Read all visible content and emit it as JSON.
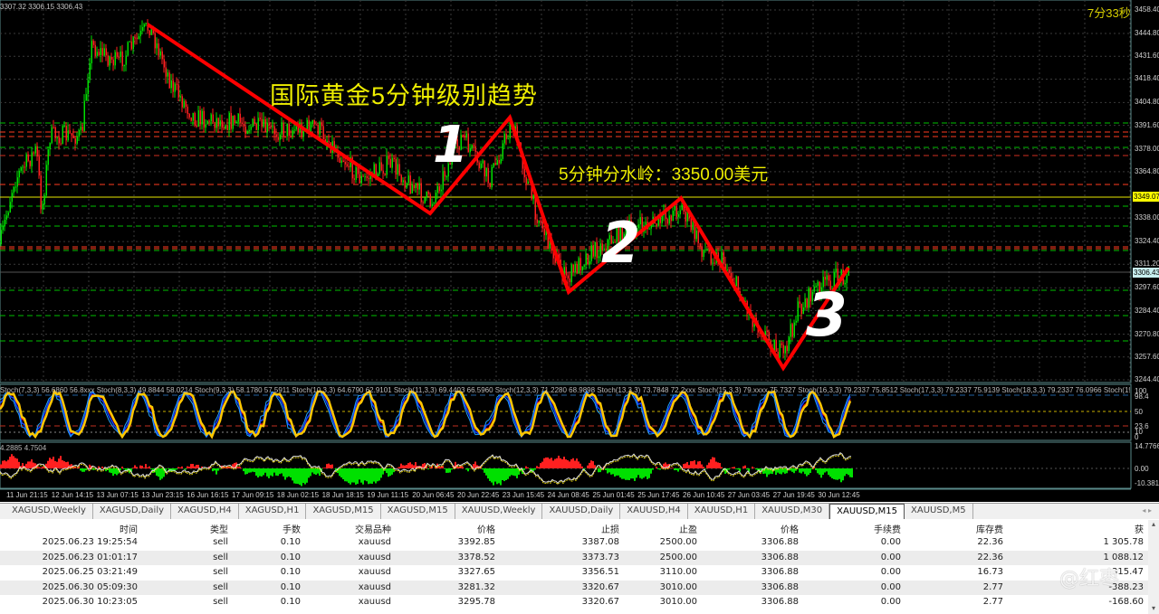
{
  "chart": {
    "ohlc_readout": "3307.32 3306.15 3306.43",
    "countdown": "7分33秒",
    "annotation_title": "国际黄金5分钟级别趋势",
    "annotation_level": "5分钟分水岭：3350.00美元",
    "wave_labels": [
      "1",
      "2",
      "3"
    ],
    "price_axis": [
      "3458.40",
      "3444.80",
      "3431.60",
      "3418.40",
      "3404.80",
      "3391.60",
      "3378.00",
      "3364.80",
      "3338.00",
      "3324.40",
      "3311.20",
      "3297.60",
      "3284.40",
      "3270.80",
      "3257.60",
      "3244.40"
    ],
    "level_tag": "3349.07",
    "current_price_tag": "3306.43",
    "stoch_label": "Stoch(7,3,3) 56.6860 56.8xxx  Stoch(8,3,3) 49.8844 58.0214  Stoch(9,3,3) 58.1780 57.5911  Stoch(10,3,3) 64.6790 62.9101  Stoch(11,3,3) 69.4403 66.5960  Stoch(12,3,3) 71.2280 68.9898  Stoch(13,3,3) 73.7848 72.2xxx  Stoch(15,3,3) 79.xxxx 75.7327  Stoch(16,3,3) 79.2337 75.8512  Stoch(17,3,3) 79.2337 75.9139  Stoch(18,3,3) 79.2337 76.0966  Stoch(19,3,3) 79.2337 76.5600  Stoch",
    "stoch_axis": [
      "100",
      "98.4",
      "50",
      "23.6",
      "10",
      "0"
    ],
    "macd_label": "4.2885 4.7504",
    "macd_axis": [
      "14.7766",
      "0.00",
      "-10.381"
    ],
    "time_axis": [
      "11 Jun 21:15",
      "12 Jun 14:15",
      "13 Jun 07:15",
      "13 Jun 23:15",
      "16 Jun 16:15",
      "17 Jun 09:15",
      "18 Jun 02:15",
      "18 Jun 18:15",
      "19 Jun 11:15",
      "20 Jun 06:45",
      "20 Jun 22:45",
      "23 Jun 15:45",
      "24 Jun 08:45",
      "25 Jun 01:45",
      "25 Jun 17:45",
      "26 Jun 10:45",
      "27 Jun 03:45",
      "27 Jun 19:45",
      "30 Jun 12:45"
    ],
    "colors": {
      "bull": "#00e000",
      "bear": "#ff2020",
      "trend_line": "#ff0000",
      "annotation": "#eeee00",
      "stoch_main": "#ffc800"
    }
  },
  "tabs": [
    {
      "label": "XAGUSD,Weekly"
    },
    {
      "label": "XAGUSD,Daily"
    },
    {
      "label": "XAGUSD,H4"
    },
    {
      "label": "XAGUSD,H1"
    },
    {
      "label": "XAGUSD,M15"
    },
    {
      "label": "XAGUSD,M15"
    },
    {
      "label": "XAUUSD,Weekly"
    },
    {
      "label": "XAUUSD,Daily"
    },
    {
      "label": "XAUUSD,H4"
    },
    {
      "label": "XAUUSD,H1"
    },
    {
      "label": "XAUUSD,M30"
    },
    {
      "label": "XAUUSD,M15",
      "active": true
    },
    {
      "label": "XAUUSD,M5"
    }
  ],
  "table": {
    "headers": [
      "时间",
      "类型",
      "手数",
      "交易品种",
      "价格",
      "止损",
      "止盈",
      "价格",
      "手续费",
      "库存费",
      "获"
    ],
    "rows": [
      [
        "2025.06.23 19:25:54",
        "sell",
        "0.10",
        "xauusd",
        "3392.85",
        "3387.08",
        "2500.00",
        "3306.88",
        "0.00",
        "22.36",
        "1 305.78"
      ],
      [
        "2025.06.23 01:01:17",
        "sell",
        "0.10",
        "xauusd",
        "3378.52",
        "3373.73",
        "2500.00",
        "3306.88",
        "0.00",
        "22.36",
        "1 088.12"
      ],
      [
        "2025.06.25 03:21:49",
        "sell",
        "0.10",
        "xauusd",
        "3327.65",
        "3356.51",
        "3110.00",
        "3306.88",
        "0.00",
        "16.73",
        "315.47"
      ],
      [
        "2025.06.30 05:09:30",
        "sell",
        "0.10",
        "xauusd",
        "3281.32",
        "3320.67",
        "3010.00",
        "3306.88",
        "0.00",
        "2.77",
        "-388.23"
      ],
      [
        "2025.06.30 10:23:05",
        "sell",
        "0.10",
        "xauusd",
        "3295.78",
        "3320.67",
        "3010.00",
        "3306.88",
        "0.00",
        "2.77",
        "-168.60"
      ]
    ]
  },
  "watermark": "@红枣"
}
